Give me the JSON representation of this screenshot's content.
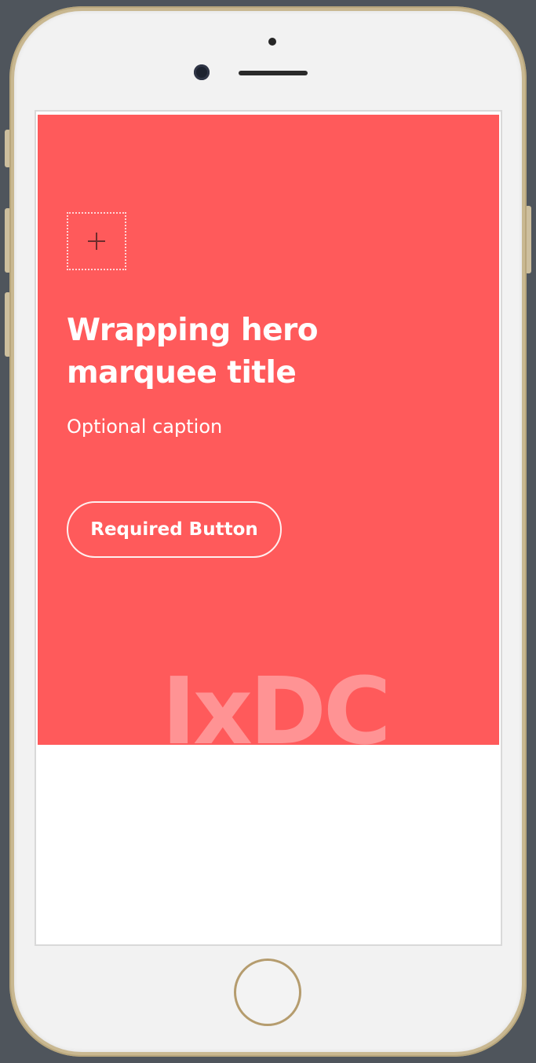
{
  "device": {
    "frame_color": "#c9b891",
    "background_color": "#4f555c"
  },
  "hero": {
    "background_color": "#ff5a5b",
    "icon": "add-icon",
    "title": "Wrapping hero marquee title",
    "caption": "Optional caption",
    "button_label": "Required Button"
  },
  "watermark": {
    "text": "IxDC"
  }
}
